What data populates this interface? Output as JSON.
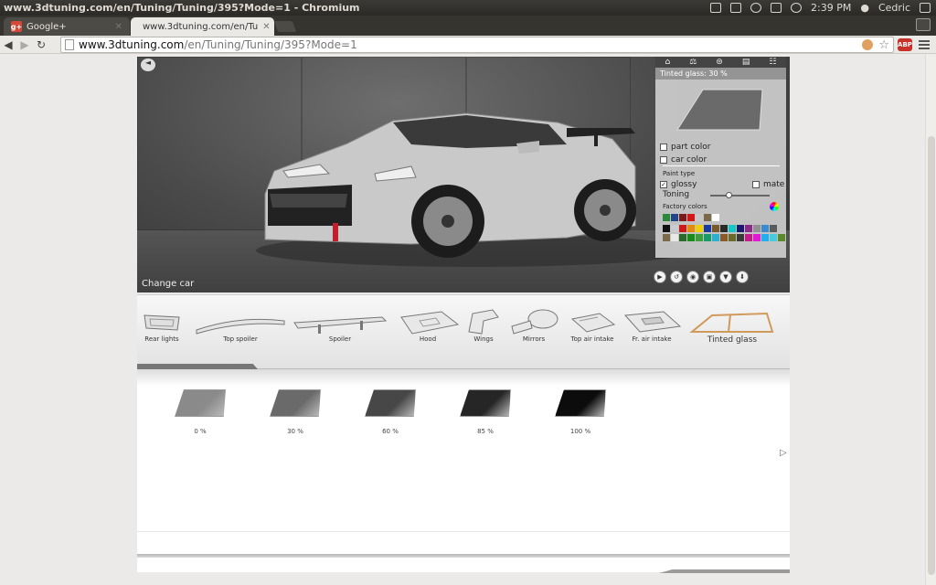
{
  "window": {
    "title": "www.3dtuning.com/en/Tuning/Tuning/395?Mode=1 - Chromium"
  },
  "tray": {
    "clock": "2:39 PM",
    "user": "Cedric"
  },
  "tabs": [
    {
      "label": "Google+"
    },
    {
      "label": "www.3dtuning.com/en/Tu"
    }
  ],
  "omnibox": {
    "host": "www.3dtuning.com",
    "path": "/en/Tuning/Tuning/395?Mode=1"
  },
  "panel": {
    "caption": "Tinted glass: 30 %",
    "part_color": "part color",
    "car_color": "car color",
    "paint_type": "Paint type",
    "glossy": "glossy",
    "mate": "mate",
    "toning": "Toning",
    "toning_level": 0.3,
    "factory_colors": "Factory colors",
    "swatches_row1": [
      "#2a8a3a",
      "#224488",
      "#7a1a1a",
      "#d01818",
      "#c8c8c8",
      "#7a6a4a",
      "#ffffff"
    ],
    "swatches_row2": [
      "#111111",
      "#c8ccd0",
      "#d01818",
      "#e08a10",
      "#f0d000",
      "#1a3ca0",
      "#7a5a2a",
      "#2a2a2a",
      "#10c8c8",
      "#1a1a6a",
      "#8a2a8a",
      "#909090",
      "#3a8ad0",
      "#5a5a5a"
    ],
    "swatches_row3": [
      "#7a6a4a",
      "#e8e8e8",
      "#2a6a2a",
      "#1a8a1a",
      "#3aa03a",
      "#1a9a6a",
      "#2ab0d0",
      "#8a5a2a",
      "#6a6a2a",
      "#3a3a3a",
      "#c81a8a",
      "#e01ad0",
      "#20b0f0",
      "#4ac8e0",
      "#5a8a2a"
    ]
  },
  "scene": {
    "change_car": "Change car"
  },
  "parts": [
    {
      "label": "Rear lights"
    },
    {
      "label": "Top spoiler"
    },
    {
      "label": "Spoiler"
    },
    {
      "label": "Hood"
    },
    {
      "label": "Wings"
    },
    {
      "label": "Mirrors"
    },
    {
      "label": "Top air intake"
    },
    {
      "label": "Fr. air intake"
    },
    {
      "label": "Tinted glass"
    }
  ],
  "options": [
    {
      "label": "0 %",
      "tint": "#8a8a8a"
    },
    {
      "label": "30 %",
      "tint": "#6a6a6a"
    },
    {
      "label": "60 %",
      "tint": "#474747"
    },
    {
      "label": "85 %",
      "tint": "#262626"
    },
    {
      "label": "100 %",
      "tint": "#0c0c0c"
    }
  ]
}
